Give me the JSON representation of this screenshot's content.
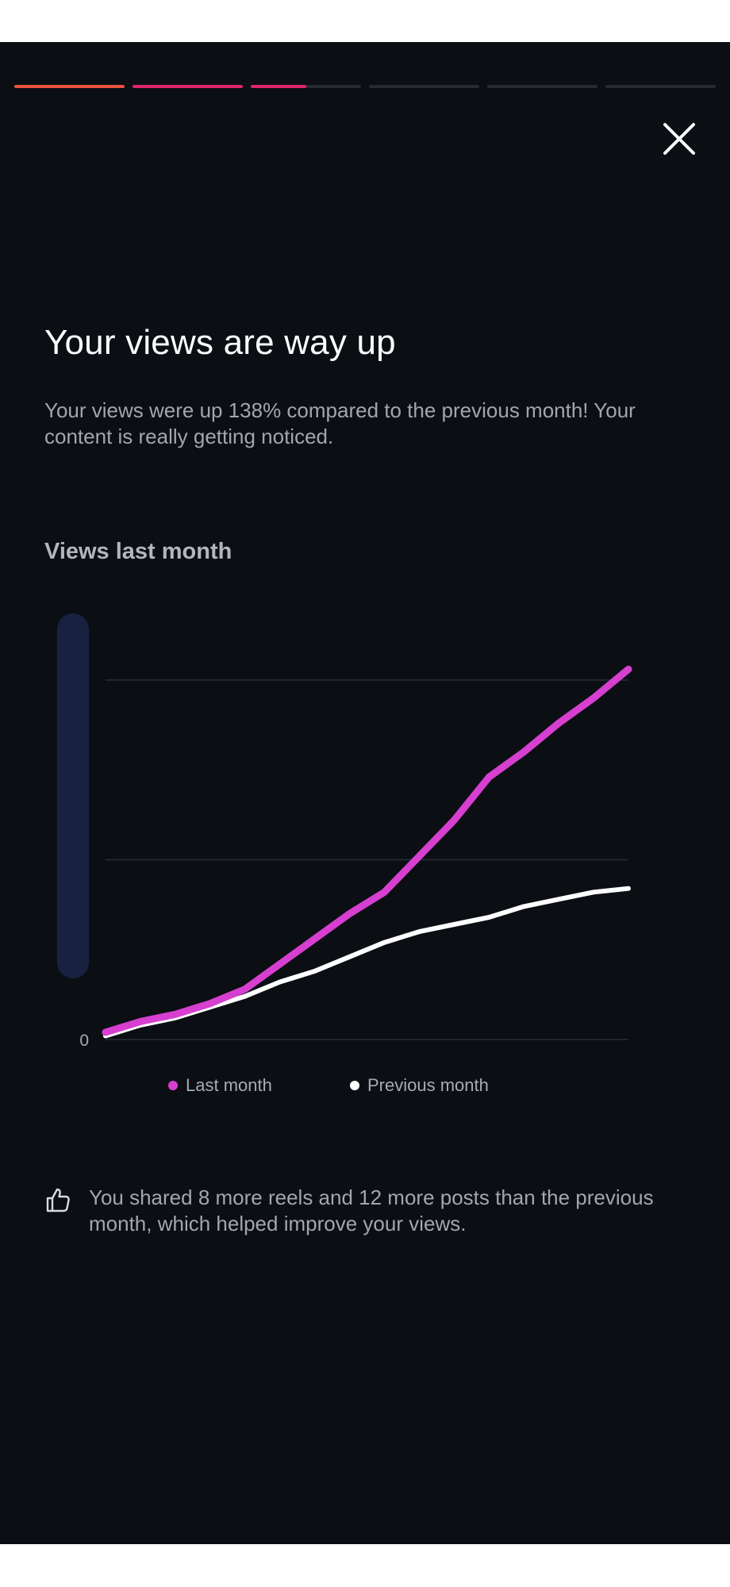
{
  "story": {
    "progress_segments": [
      {
        "fill": 1.0,
        "color": "#e8543c"
      },
      {
        "fill": 1.0,
        "color": "#e0256b"
      },
      {
        "fill": 0.5,
        "color": "#e0256b"
      },
      {
        "fill": 0.0,
        "color": "#262a31"
      },
      {
        "fill": 0.0,
        "color": "#262a31"
      },
      {
        "fill": 0.0,
        "color": "#262a31"
      }
    ],
    "close_icon": "close-icon"
  },
  "header": {
    "title": "Your views are way up",
    "subtitle": "Your views were up 138% compared to the previous month! Your content is really getting noticed."
  },
  "chart_section": {
    "title": "Views last month"
  },
  "chart_data": {
    "type": "line",
    "title": "Views last month",
    "x": [
      1,
      2,
      3,
      4,
      5,
      6,
      7,
      8,
      9,
      10,
      11,
      12,
      13,
      14,
      15,
      16
    ],
    "ylim": [
      0,
      100
    ],
    "yticks": [
      {
        "value": 0,
        "label": "0"
      },
      {
        "value": 50,
        "label": ""
      },
      {
        "value": 100,
        "label": ""
      }
    ],
    "grid": true,
    "legend": "bottom",
    "series": [
      {
        "name": "Last month",
        "color": "#d63fd0",
        "values": [
          2,
          5,
          7,
          10,
          14,
          21,
          28,
          35,
          41,
          51,
          61,
          73,
          80,
          88,
          95,
          103
        ]
      },
      {
        "name": "Previous month",
        "color": "#ffffff",
        "values": [
          1,
          4,
          6,
          9,
          12,
          16,
          19,
          23,
          27,
          30,
          32,
          34,
          37,
          39,
          41,
          42
        ]
      }
    ]
  },
  "insight": {
    "icon": "thumbs-up-icon",
    "text": "You shared 8 more reels and 12 more posts than the previous month, which helped improve your views."
  }
}
